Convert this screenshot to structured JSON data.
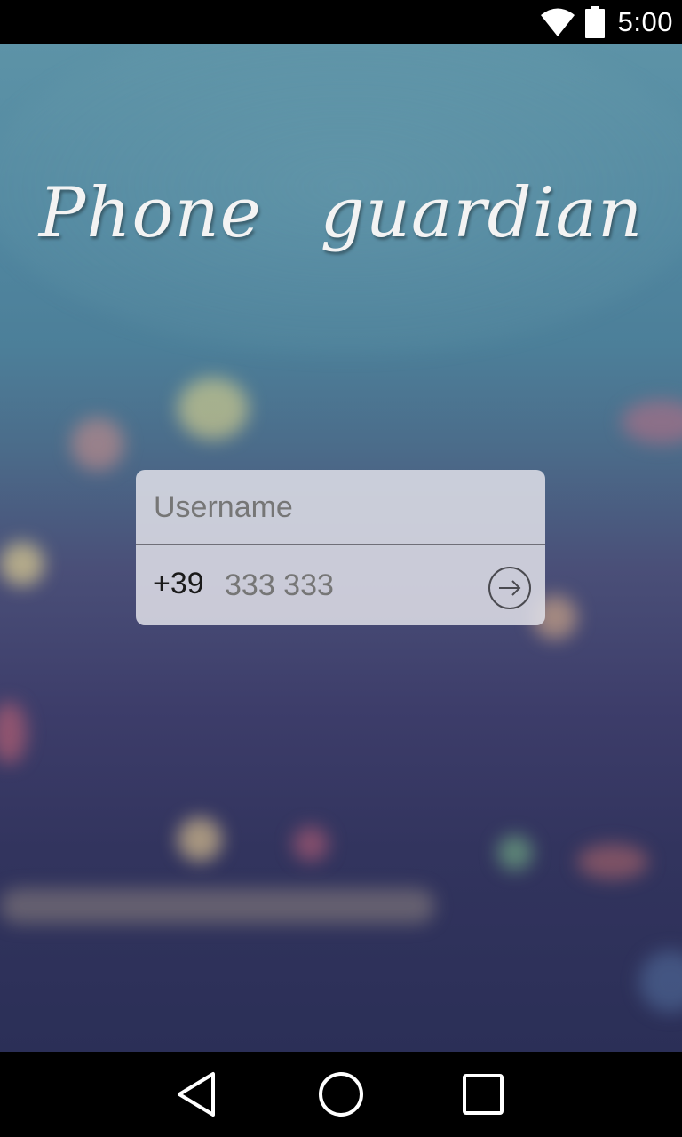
{
  "status_bar": {
    "time": "5:00",
    "icons": [
      "wifi-icon",
      "battery-icon"
    ]
  },
  "app": {
    "title": "Phone guardian"
  },
  "login": {
    "username_placeholder": "Username",
    "username_value": "",
    "country_code": "+39",
    "phone_placeholder": "333 333",
    "phone_value": "",
    "submit_icon": "arrow-right-circle-icon"
  },
  "nav_bar": {
    "items": [
      "back-icon",
      "home-icon",
      "recents-icon"
    ]
  },
  "colors": {
    "status_bar": "#000000",
    "card": "#e0e0e8",
    "title_text": "#f3f3f3",
    "sky_top": "#5d93a7",
    "background_bottom": "#2b2f57"
  }
}
